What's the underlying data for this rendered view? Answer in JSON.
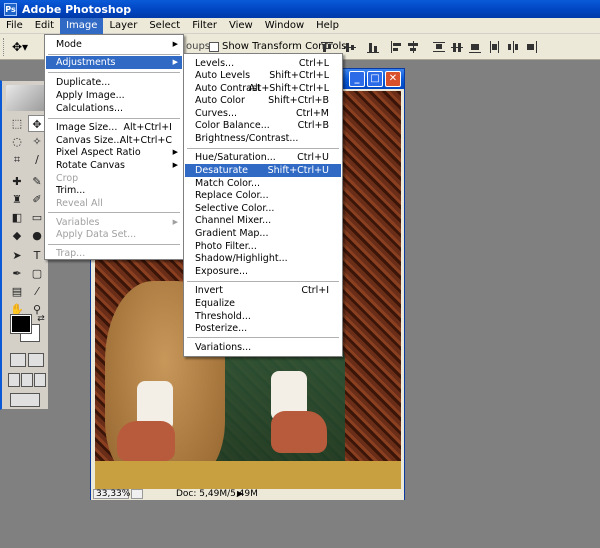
{
  "app": {
    "title": "Adobe Photoshop",
    "logo_text": "Ps"
  },
  "menubar": [
    "File",
    "Edit",
    "Image",
    "Layer",
    "Select",
    "Filter",
    "View",
    "Window",
    "Help"
  ],
  "options": {
    "fragment": "oups",
    "show_transform_controls": "Show Transform Controls"
  },
  "image_menu": [
    {
      "label": "Mode",
      "submenu": true
    },
    {
      "label": "Adjustments",
      "submenu": true,
      "highlight": true
    },
    {
      "label": "Duplicate..."
    },
    {
      "label": "Apply Image..."
    },
    {
      "label": "Calculations..."
    },
    {
      "label": "Image Size...",
      "shortcut": "Alt+Ctrl+I"
    },
    {
      "label": "Canvas Size...",
      "shortcut": "Alt+Ctrl+C"
    },
    {
      "label": "Pixel Aspect Ratio",
      "submenu": true
    },
    {
      "label": "Rotate Canvas",
      "submenu": true
    },
    {
      "label": "Crop",
      "disabled": true
    },
    {
      "label": "Trim..."
    },
    {
      "label": "Reveal All",
      "disabled": true
    },
    {
      "label": "Variables",
      "submenu": true,
      "disabled": true
    },
    {
      "label": "Apply Data Set...",
      "disabled": true
    },
    {
      "label": "Trap...",
      "disabled": true
    }
  ],
  "adjustments_menu": [
    {
      "label": "Levels...",
      "shortcut": "Ctrl+L"
    },
    {
      "label": "Auto Levels",
      "shortcut": "Shift+Ctrl+L"
    },
    {
      "label": "Auto Contrast",
      "shortcut": "Alt+Shift+Ctrl+L"
    },
    {
      "label": "Auto Color",
      "shortcut": "Shift+Ctrl+B"
    },
    {
      "label": "Curves...",
      "shortcut": "Ctrl+M"
    },
    {
      "label": "Color Balance...",
      "shortcut": "Ctrl+B"
    },
    {
      "label": "Brightness/Contrast..."
    },
    {
      "label": "Hue/Saturation...",
      "shortcut": "Ctrl+U"
    },
    {
      "label": "Desaturate",
      "shortcut": "Shift+Ctrl+U",
      "highlight": true
    },
    {
      "label": "Match Color..."
    },
    {
      "label": "Replace Color..."
    },
    {
      "label": "Selective Color..."
    },
    {
      "label": "Channel Mixer..."
    },
    {
      "label": "Gradient Map..."
    },
    {
      "label": "Photo Filter..."
    },
    {
      "label": "Shadow/Highlight..."
    },
    {
      "label": "Exposure..."
    },
    {
      "label": "Invert",
      "shortcut": "Ctrl+I"
    },
    {
      "label": "Equalize"
    },
    {
      "label": "Threshold..."
    },
    {
      "label": "Posterize..."
    },
    {
      "label": "Variations..."
    }
  ],
  "document": {
    "zoom": "33,33%",
    "doc_info": "Doc: 5,49M/5,49M"
  },
  "colors": {
    "accent": "#316ac5",
    "title_blue": "#0a5ad8",
    "chrome": "#ece9d8",
    "workspace": "#808080"
  }
}
